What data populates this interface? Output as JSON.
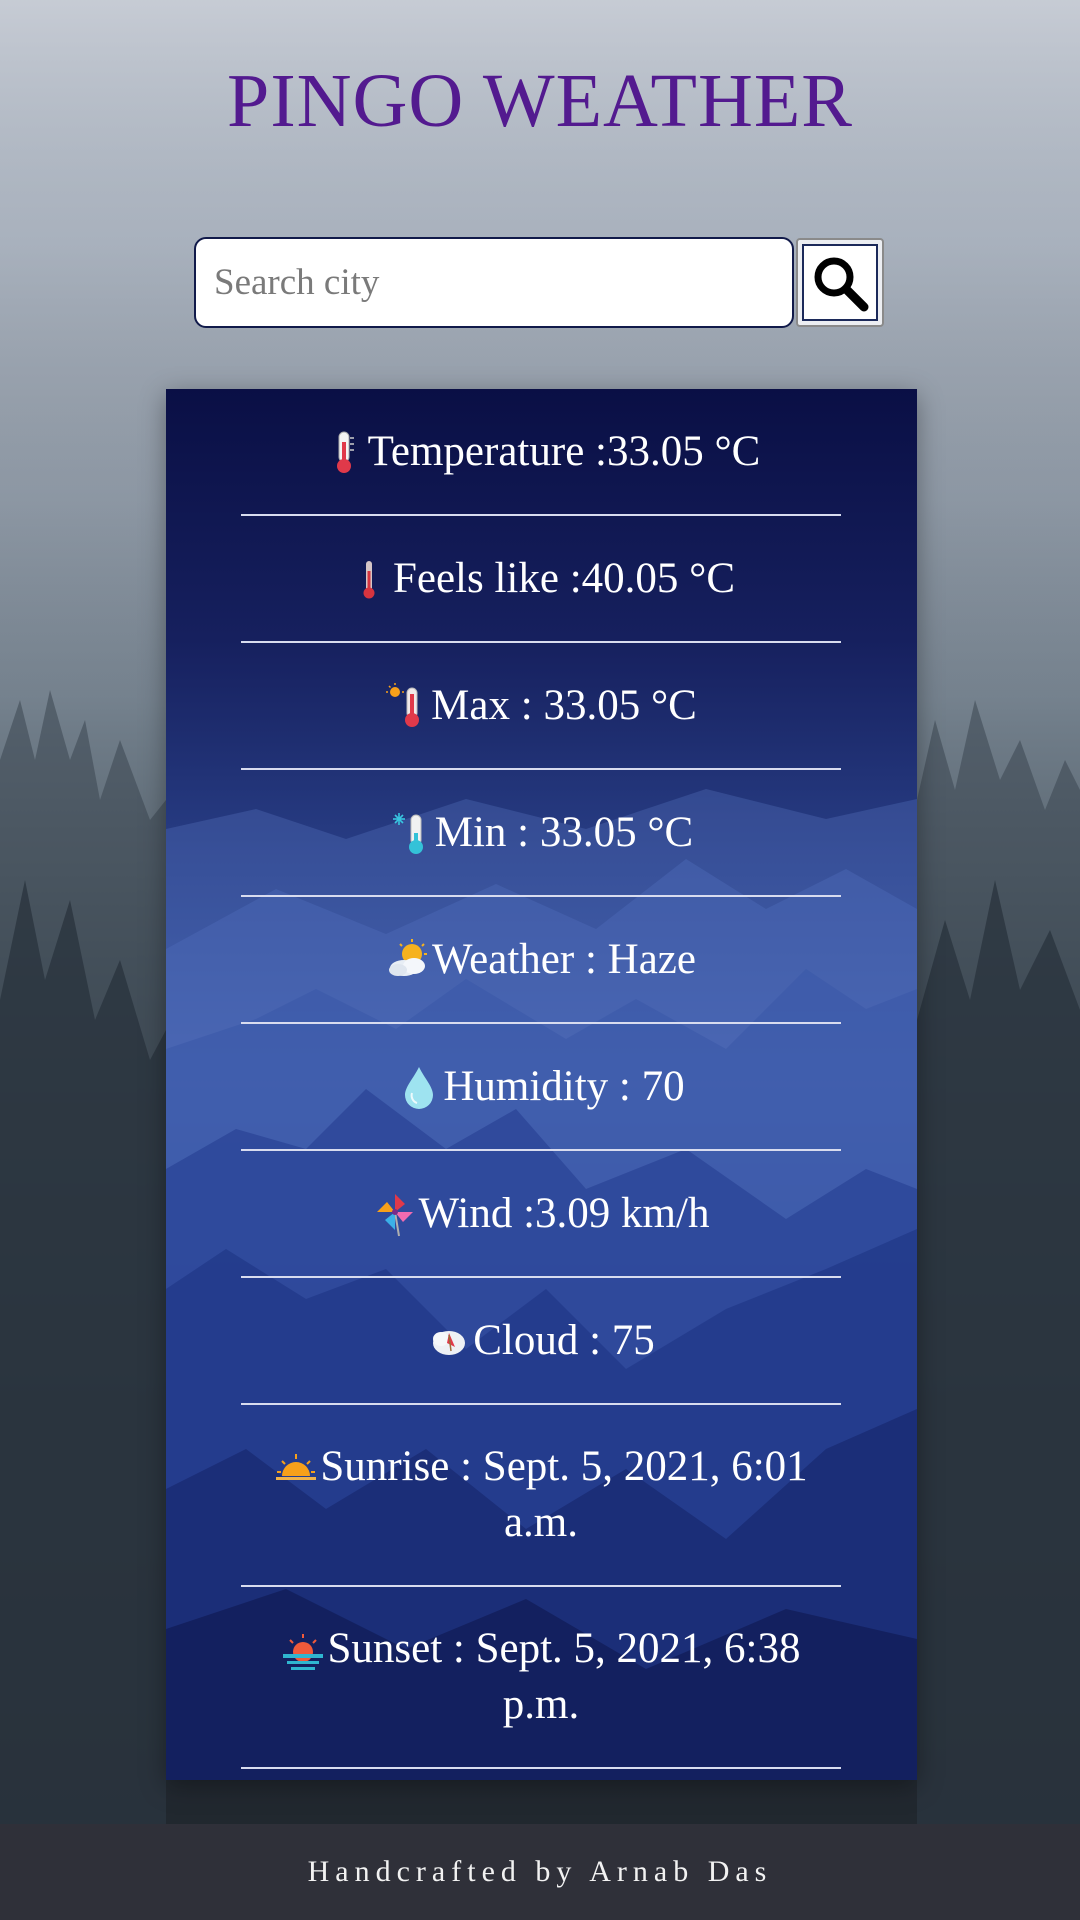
{
  "app": {
    "title": "PINGO WEATHER"
  },
  "search": {
    "placeholder": "Search city",
    "value": ""
  },
  "search_button": {
    "icon": "search-icon"
  },
  "weather": {
    "rows": [
      {
        "icon": "thermometer-icon",
        "label": "Temperature :33.05 °C"
      },
      {
        "icon": "thermometer-icon",
        "label": "Feels like :40.05 °C"
      },
      {
        "icon": "hot-thermometer-icon",
        "label": "Max : 33.05 °C"
      },
      {
        "icon": "cold-thermometer-icon",
        "label": "Min : 33.05 °C"
      },
      {
        "icon": "sun-behind-cloud-icon",
        "label": "Weather : Haze"
      },
      {
        "icon": "droplet-icon",
        "label": "Humidity : 70"
      },
      {
        "icon": "pinwheel-icon",
        "label": "Wind :3.09 km/h"
      },
      {
        "icon": "cloud-icon",
        "label": "Cloud : 75"
      },
      {
        "icon": "sunrise-icon",
        "label": "Sunrise : Sept. 5, 2021, 6:01",
        "label_2": "a.m."
      },
      {
        "icon": "sunset-icon",
        "label": "Sunset : Sept. 5, 2021, 6:38",
        "label_2": "p.m."
      }
    ]
  },
  "footer": {
    "text": "Handcrafted by Arnab Das"
  },
  "colors": {
    "title": "#531a8f",
    "card_top": "#0c1247",
    "card_mid": "#3a5aa6",
    "footer_bg": "#2f3039"
  }
}
